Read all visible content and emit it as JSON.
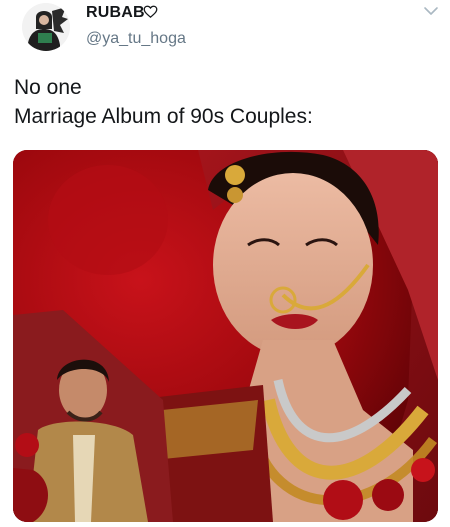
{
  "tweet": {
    "author": {
      "display_name": "RUBAB",
      "handle": "@ya_tu_hoga",
      "name_suffix_icon": "heart-outline-icon",
      "avatar_icon": "profile-avatar"
    },
    "menu_icon": "chevron-down-icon",
    "text_lines": [
      "No one",
      "Marriage Album of 90s Couples:"
    ],
    "media": {
      "description_icon": "wedding-photo",
      "colors": {
        "background_red": "#b3090f",
        "dupatta_red": "#8e0d12",
        "gold": "#d9a93a",
        "skin": "#e0a98d"
      }
    }
  },
  "colors": {
    "text": "#14171a",
    "secondary_text": "#657786",
    "chevron": "#aab8c2"
  }
}
